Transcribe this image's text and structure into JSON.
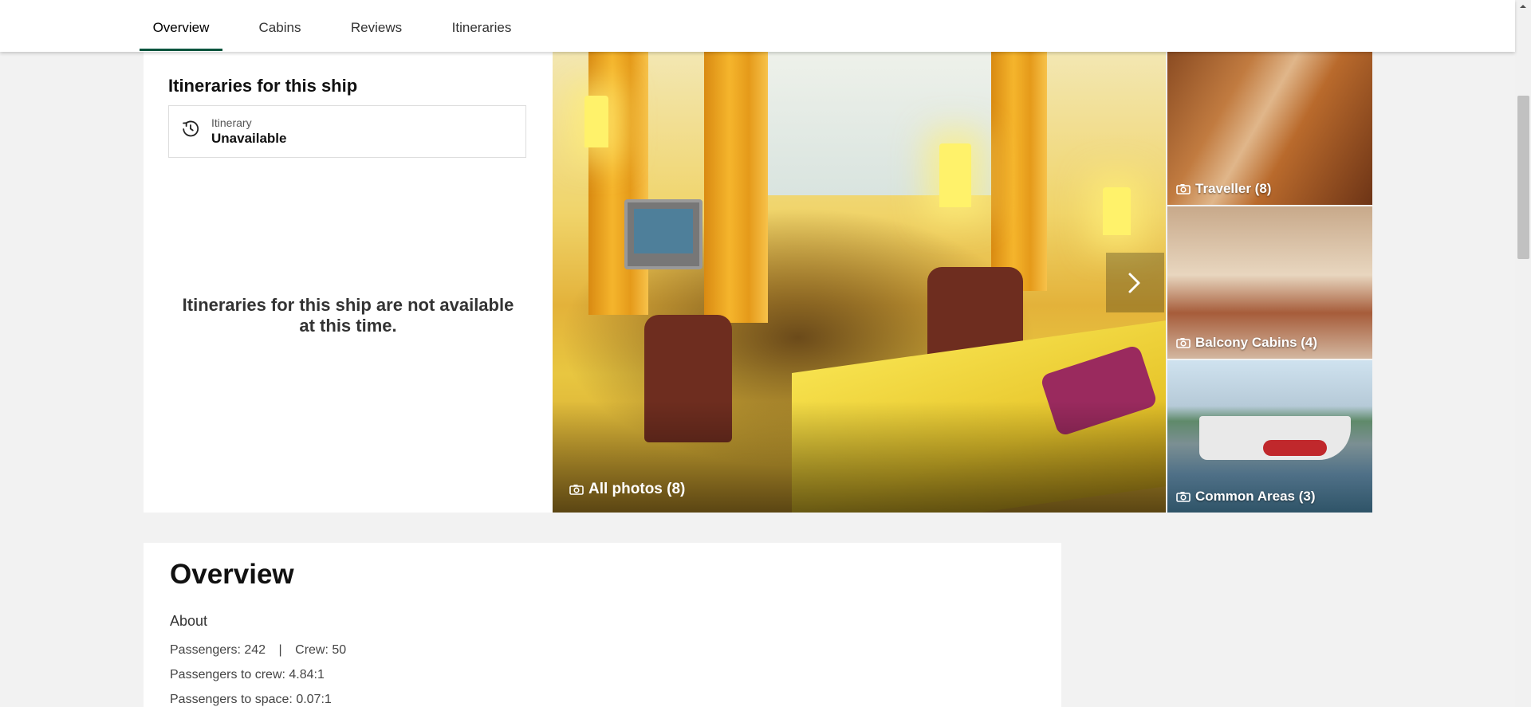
{
  "nav": {
    "tabs": [
      {
        "label": "Overview",
        "active": true
      },
      {
        "label": "Cabins",
        "active": false
      },
      {
        "label": "Reviews",
        "active": false
      },
      {
        "label": "Itineraries",
        "active": false
      }
    ],
    "accent": "#00543d"
  },
  "itineraries": {
    "title": "Itineraries for this ship",
    "box_label": "Itinerary",
    "box_value": "Unavailable",
    "icon": "clock-history-icon",
    "message_line1": "Itineraries for this ship are not available",
    "message_line2": "at this time."
  },
  "photos": {
    "main_caption": "All photos (8)",
    "side": [
      {
        "caption": "Traveller (8)"
      },
      {
        "caption": "Balcony Cabins (4)"
      },
      {
        "caption": "Common Areas (3)"
      }
    ],
    "camera_icon": "camera-icon",
    "next_icon": "chevron-right-icon"
  },
  "overview": {
    "title": "Overview",
    "about_heading": "About",
    "passengers": "Passengers: 242",
    "separator": "|",
    "crew": "Crew: 50",
    "passengers_to_crew": "Passengers to crew: 4.84:1",
    "passengers_to_space": "Passengers to space: 0.07:1"
  }
}
